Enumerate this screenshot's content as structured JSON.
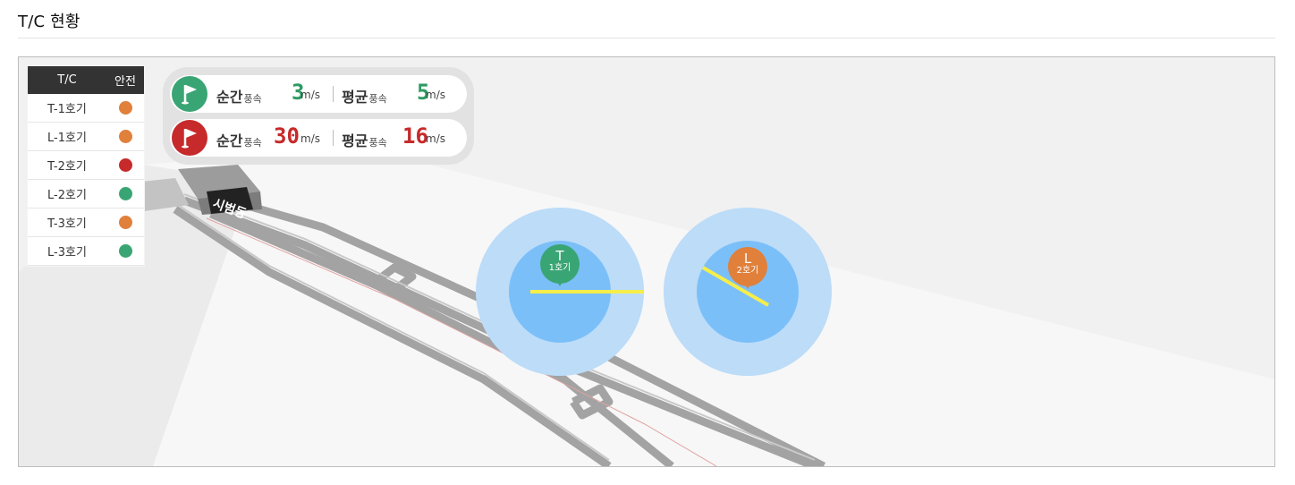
{
  "page": {
    "title": "T/C 현황"
  },
  "tc_table": {
    "headers": [
      "T/C",
      "안전"
    ],
    "rows": [
      {
        "name": "T-1호기",
        "status_color": "#e0803b"
      },
      {
        "name": "L-1호기",
        "status_color": "#e0803b"
      },
      {
        "name": "T-2호기",
        "status_color": "#c62a2a"
      },
      {
        "name": "L-2호기",
        "status_color": "#3aa574"
      },
      {
        "name": "T-3호기",
        "status_color": "#e0803b"
      },
      {
        "name": "L-3호기",
        "status_color": "#3aa574"
      }
    ]
  },
  "wind": {
    "rows": [
      {
        "flag_icon": "flag-icon",
        "flag_color": "#3aa574",
        "instant_label": "순간",
        "instant_suffix": "풍속",
        "instant_value": "3",
        "avg_label": "평균",
        "avg_suffix": "풍속",
        "avg_value": "5",
        "unit": "m/s",
        "value_color": "#2e9a63"
      },
      {
        "flag_icon": "flag-icon",
        "flag_color": "#c62a2a",
        "instant_label": "순간",
        "instant_suffix": "풍속",
        "instant_value": "30",
        "avg_label": "평균",
        "avg_suffix": "풍속",
        "avg_value": "16",
        "unit": "m/s",
        "value_color": "#c62a2a"
      }
    ]
  },
  "cranes": [
    {
      "letter": "T",
      "label": "1호기",
      "color": "#3aa574"
    },
    {
      "letter": "L",
      "label": "2호기",
      "color": "#e0803b"
    }
  ],
  "map": {
    "building_label": "시범동"
  }
}
